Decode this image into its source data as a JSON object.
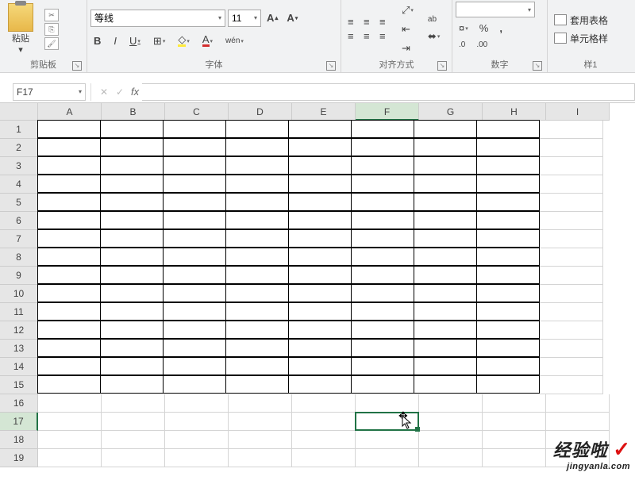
{
  "ribbon": {
    "clipboard": {
      "paste_label": "粘贴",
      "group_label": "剪贴板"
    },
    "font": {
      "name": "等线",
      "size": "11",
      "bold": "B",
      "italic": "I",
      "underline": "U",
      "wen": "wén",
      "fill_char": "A",
      "fill_color": "#ffeb3b",
      "bucket_char": "◇",
      "font_color_char": "A",
      "font_color": "#d32f2f",
      "group_label": "字体"
    },
    "alignment": {
      "group_label": "对齐方式",
      "wrap": "ab",
      "merge": "⬌"
    },
    "number": {
      "group_label": "数字",
      "format": "",
      "percent": "%",
      "comma": ",",
      "inc_dec": ".0",
      "dec_inc": ".00"
    },
    "styles": {
      "group_label": "样1",
      "table_format": "套用表格",
      "cell_styles": "单元格样"
    }
  },
  "formula_bar": {
    "name_box": "F17",
    "cancel": "✕",
    "enter": "✓",
    "fx": "fx",
    "value": ""
  },
  "columns": [
    "A",
    "B",
    "C",
    "D",
    "E",
    "F",
    "G",
    "H",
    "I"
  ],
  "active_column_index": 5,
  "visible_rows": 19,
  "bordered_rows": 15,
  "bordered_cols": 8,
  "active_row": 17,
  "selection": {
    "col": 5,
    "row": 17
  },
  "watermark": {
    "main": "经验啦",
    "check": "✓",
    "sub": "jingyanla.com"
  }
}
